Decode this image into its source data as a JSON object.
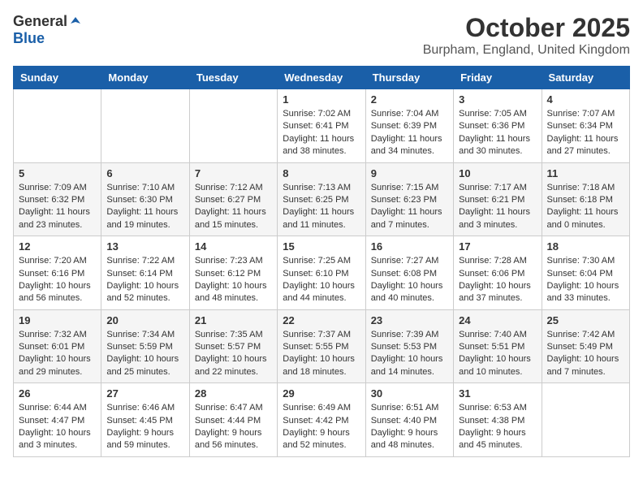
{
  "logo": {
    "general": "General",
    "blue": "Blue"
  },
  "header": {
    "month": "October 2025",
    "location": "Burpham, England, United Kingdom"
  },
  "days_of_week": [
    "Sunday",
    "Monday",
    "Tuesday",
    "Wednesday",
    "Thursday",
    "Friday",
    "Saturday"
  ],
  "weeks": [
    [
      {
        "day": "",
        "info": ""
      },
      {
        "day": "",
        "info": ""
      },
      {
        "day": "",
        "info": ""
      },
      {
        "day": "1",
        "info": "Sunrise: 7:02 AM\nSunset: 6:41 PM\nDaylight: 11 hours\nand 38 minutes."
      },
      {
        "day": "2",
        "info": "Sunrise: 7:04 AM\nSunset: 6:39 PM\nDaylight: 11 hours\nand 34 minutes."
      },
      {
        "day": "3",
        "info": "Sunrise: 7:05 AM\nSunset: 6:36 PM\nDaylight: 11 hours\nand 30 minutes."
      },
      {
        "day": "4",
        "info": "Sunrise: 7:07 AM\nSunset: 6:34 PM\nDaylight: 11 hours\nand 27 minutes."
      }
    ],
    [
      {
        "day": "5",
        "info": "Sunrise: 7:09 AM\nSunset: 6:32 PM\nDaylight: 11 hours\nand 23 minutes."
      },
      {
        "day": "6",
        "info": "Sunrise: 7:10 AM\nSunset: 6:30 PM\nDaylight: 11 hours\nand 19 minutes."
      },
      {
        "day": "7",
        "info": "Sunrise: 7:12 AM\nSunset: 6:27 PM\nDaylight: 11 hours\nand 15 minutes."
      },
      {
        "day": "8",
        "info": "Sunrise: 7:13 AM\nSunset: 6:25 PM\nDaylight: 11 hours\nand 11 minutes."
      },
      {
        "day": "9",
        "info": "Sunrise: 7:15 AM\nSunset: 6:23 PM\nDaylight: 11 hours\nand 7 minutes."
      },
      {
        "day": "10",
        "info": "Sunrise: 7:17 AM\nSunset: 6:21 PM\nDaylight: 11 hours\nand 3 minutes."
      },
      {
        "day": "11",
        "info": "Sunrise: 7:18 AM\nSunset: 6:18 PM\nDaylight: 11 hours\nand 0 minutes."
      }
    ],
    [
      {
        "day": "12",
        "info": "Sunrise: 7:20 AM\nSunset: 6:16 PM\nDaylight: 10 hours\nand 56 minutes."
      },
      {
        "day": "13",
        "info": "Sunrise: 7:22 AM\nSunset: 6:14 PM\nDaylight: 10 hours\nand 52 minutes."
      },
      {
        "day": "14",
        "info": "Sunrise: 7:23 AM\nSunset: 6:12 PM\nDaylight: 10 hours\nand 48 minutes."
      },
      {
        "day": "15",
        "info": "Sunrise: 7:25 AM\nSunset: 6:10 PM\nDaylight: 10 hours\nand 44 minutes."
      },
      {
        "day": "16",
        "info": "Sunrise: 7:27 AM\nSunset: 6:08 PM\nDaylight: 10 hours\nand 40 minutes."
      },
      {
        "day": "17",
        "info": "Sunrise: 7:28 AM\nSunset: 6:06 PM\nDaylight: 10 hours\nand 37 minutes."
      },
      {
        "day": "18",
        "info": "Sunrise: 7:30 AM\nSunset: 6:04 PM\nDaylight: 10 hours\nand 33 minutes."
      }
    ],
    [
      {
        "day": "19",
        "info": "Sunrise: 7:32 AM\nSunset: 6:01 PM\nDaylight: 10 hours\nand 29 minutes."
      },
      {
        "day": "20",
        "info": "Sunrise: 7:34 AM\nSunset: 5:59 PM\nDaylight: 10 hours\nand 25 minutes."
      },
      {
        "day": "21",
        "info": "Sunrise: 7:35 AM\nSunset: 5:57 PM\nDaylight: 10 hours\nand 22 minutes."
      },
      {
        "day": "22",
        "info": "Sunrise: 7:37 AM\nSunset: 5:55 PM\nDaylight: 10 hours\nand 18 minutes."
      },
      {
        "day": "23",
        "info": "Sunrise: 7:39 AM\nSunset: 5:53 PM\nDaylight: 10 hours\nand 14 minutes."
      },
      {
        "day": "24",
        "info": "Sunrise: 7:40 AM\nSunset: 5:51 PM\nDaylight: 10 hours\nand 10 minutes."
      },
      {
        "day": "25",
        "info": "Sunrise: 7:42 AM\nSunset: 5:49 PM\nDaylight: 10 hours\nand 7 minutes."
      }
    ],
    [
      {
        "day": "26",
        "info": "Sunrise: 6:44 AM\nSunset: 4:47 PM\nDaylight: 10 hours\nand 3 minutes."
      },
      {
        "day": "27",
        "info": "Sunrise: 6:46 AM\nSunset: 4:45 PM\nDaylight: 9 hours\nand 59 minutes."
      },
      {
        "day": "28",
        "info": "Sunrise: 6:47 AM\nSunset: 4:44 PM\nDaylight: 9 hours\nand 56 minutes."
      },
      {
        "day": "29",
        "info": "Sunrise: 6:49 AM\nSunset: 4:42 PM\nDaylight: 9 hours\nand 52 minutes."
      },
      {
        "day": "30",
        "info": "Sunrise: 6:51 AM\nSunset: 4:40 PM\nDaylight: 9 hours\nand 48 minutes."
      },
      {
        "day": "31",
        "info": "Sunrise: 6:53 AM\nSunset: 4:38 PM\nDaylight: 9 hours\nand 45 minutes."
      },
      {
        "day": "",
        "info": ""
      }
    ]
  ]
}
